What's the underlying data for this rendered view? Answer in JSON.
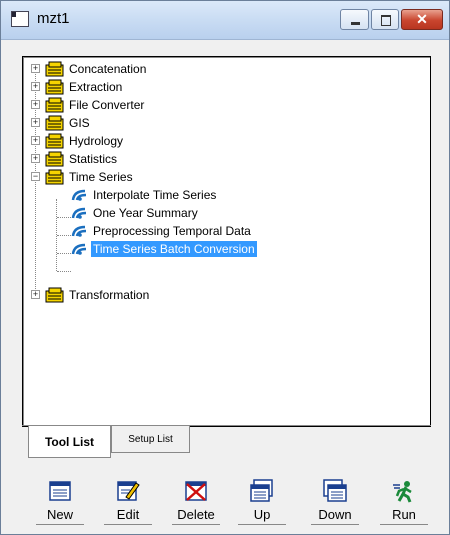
{
  "window": {
    "title": "mzt1"
  },
  "tree": {
    "folders": [
      {
        "label": "Concatenation",
        "expander": "+"
      },
      {
        "label": "Extraction",
        "expander": "+"
      },
      {
        "label": "File Converter",
        "expander": "+"
      },
      {
        "label": "GIS",
        "expander": "+"
      },
      {
        "label": "Hydrology",
        "expander": "+"
      },
      {
        "label": "Statistics",
        "expander": "+"
      },
      {
        "label": "Time Series",
        "expander": "−"
      }
    ],
    "time_series_children": [
      {
        "label": "Interpolate Time Series"
      },
      {
        "label": "One Year Summary"
      },
      {
        "label": "Preprocessing Temporal Data"
      },
      {
        "label": "Time Series Batch Conversion",
        "selected": true
      }
    ],
    "last_folder": {
      "label": "Transformation",
      "expander": "+"
    }
  },
  "tabs": {
    "tool_list": "Tool List",
    "setup_list": "Setup List"
  },
  "toolbar": {
    "new": "New",
    "edit": "Edit",
    "delete": "Delete",
    "up": "Up",
    "down": "Down",
    "run": "Run"
  },
  "colors": {
    "selection": "#3399ff",
    "folder": "#f5d400",
    "tool_icon": "#1b6fbf",
    "close": "#c9452e"
  }
}
